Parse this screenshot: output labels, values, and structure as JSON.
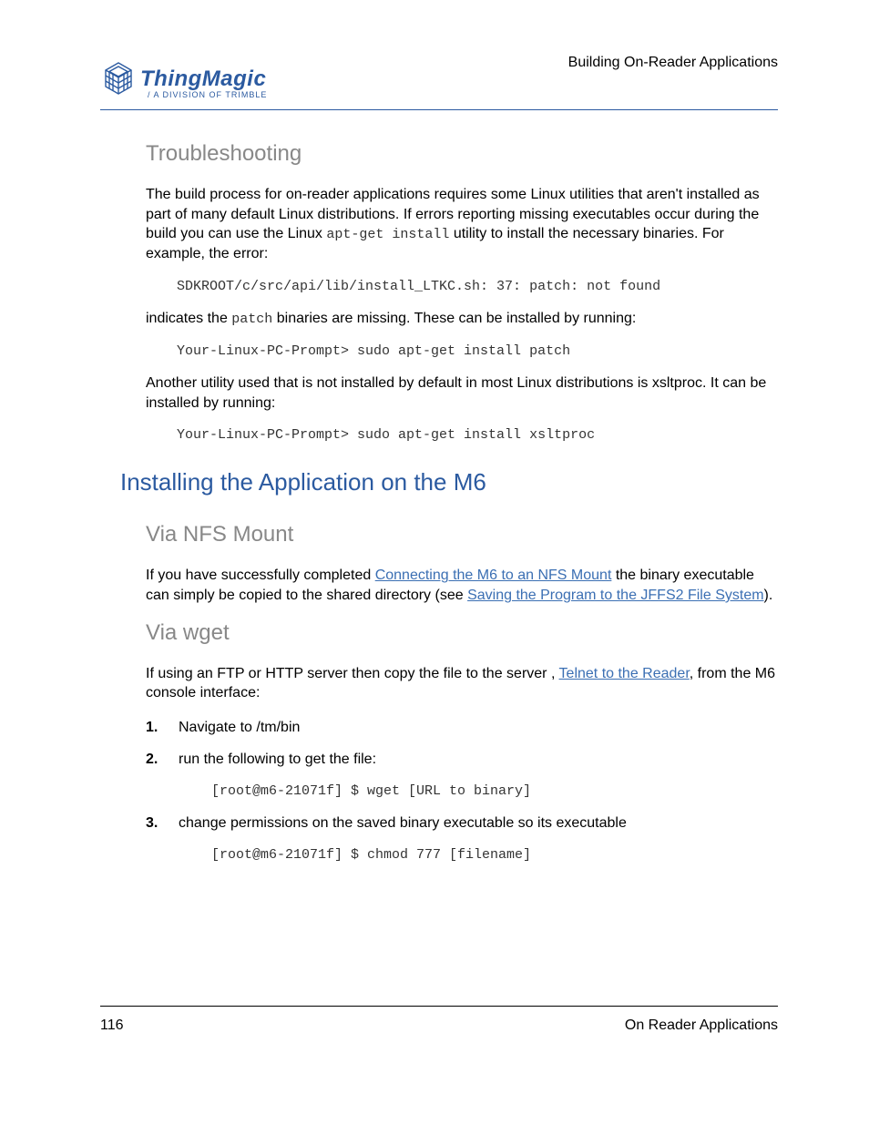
{
  "header": {
    "logo_main": "ThingMagic",
    "logo_sub_prefix": "/ ",
    "logo_sub": "A DIVISION OF TRIMBLE",
    "right": "Building On-Reader Applications"
  },
  "troubleshooting": {
    "title": "Troubleshooting",
    "p1_a": "The build process for on-reader applications requires some Linux utilities that aren't installed as part of many default Linux distributions. If errors reporting missing executables occur during the build you can use the Linux ",
    "p1_code": "apt-get install",
    "p1_b": " utility to install the necessary binaries. For example, the error:",
    "code1": "SDKROOT/c/src/api/lib/install_LTKC.sh: 37: patch: not found",
    "p2_a": "indicates the ",
    "p2_code": "patch",
    "p2_b": " binaries are missing. These can be installed by running:",
    "code2": "Your-Linux-PC-Prompt> sudo apt-get install patch",
    "p3": "Another utility used that is not installed by default in most Linux distributions is xsltproc. It can be installed by running:",
    "code3": "Your-Linux-PC-Prompt> sudo apt-get install xsltproc"
  },
  "installing": {
    "title": "Installing the Application on the M6",
    "nfs": {
      "title": "Via NFS Mount",
      "p_a": "If you have successfully completed ",
      "link1": "Connecting the M6 to an NFS Mount",
      "p_b": " the binary executable can simply be copied to the shared directory (see ",
      "link2": "Saving the Program to the JFFS2 File System",
      "p_c": ")."
    },
    "wget": {
      "title": "Via wget",
      "p_a": "If using an FTP or HTTP server then copy the file to the server , ",
      "link": "Telnet to the Reader",
      "p_b": ", from the M6 console interface:",
      "steps": [
        {
          "text": "Navigate to /tm/bin"
        },
        {
          "text": "run the following to get the file:",
          "code": "[root@m6-21071f] $ wget [URL to binary]"
        },
        {
          "text": "change permissions on the saved binary executable so its executable",
          "code": "[root@m6-21071f] $ chmod 777 [filename]"
        }
      ]
    }
  },
  "footer": {
    "page": "116",
    "right": "On Reader Applications"
  }
}
